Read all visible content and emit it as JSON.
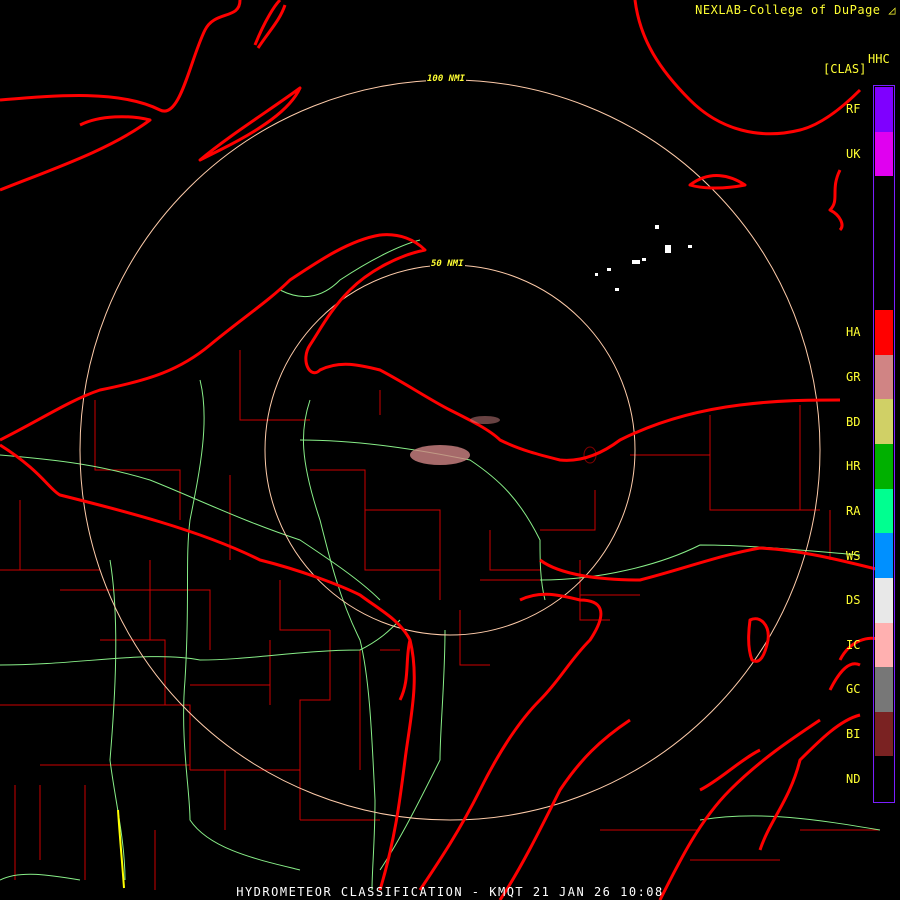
{
  "header": {
    "credit": "NEXLAB-College of DuPage",
    "credit_icon": "nexlab-logo-icon",
    "product_code": "HHC",
    "product_unit": "[CLAS]"
  },
  "rings": [
    {
      "label": "100 NMI"
    },
    {
      "label": "50 NMI"
    }
  ],
  "legend": [
    {
      "code": "RF",
      "color": "#7f00ff"
    },
    {
      "code": "UK",
      "color": "#e000f0"
    },
    {
      "code": "",
      "color": "#000000"
    },
    {
      "code": "",
      "color": "#000000"
    },
    {
      "code": "",
      "color": "#000000"
    },
    {
      "code": "HA",
      "color": "#ff0000"
    },
    {
      "code": "GR",
      "color": "#d08484"
    },
    {
      "code": "BD",
      "color": "#d0d066"
    },
    {
      "code": "HR",
      "color": "#00b000"
    },
    {
      "code": "RA",
      "color": "#00ff90"
    },
    {
      "code": "WS",
      "color": "#0090ff"
    },
    {
      "code": "DS",
      "color": "#e8e8e8"
    },
    {
      "code": "IC",
      "color": "#ffb0b0"
    },
    {
      "code": "GC",
      "color": "#777777"
    },
    {
      "code": "BI",
      "color": "#7a2222"
    },
    {
      "code": "ND",
      "color": "#000000"
    }
  ],
  "footer": {
    "title": "HYDROMETEOR CLASSIFICATION - KMQT 21 JAN 26 10:08"
  },
  "colors": {
    "coast": "#ff0000",
    "county": "#cc0000",
    "river": "#88ee88",
    "ring": "#ffccaa",
    "text": "#ffff33"
  }
}
